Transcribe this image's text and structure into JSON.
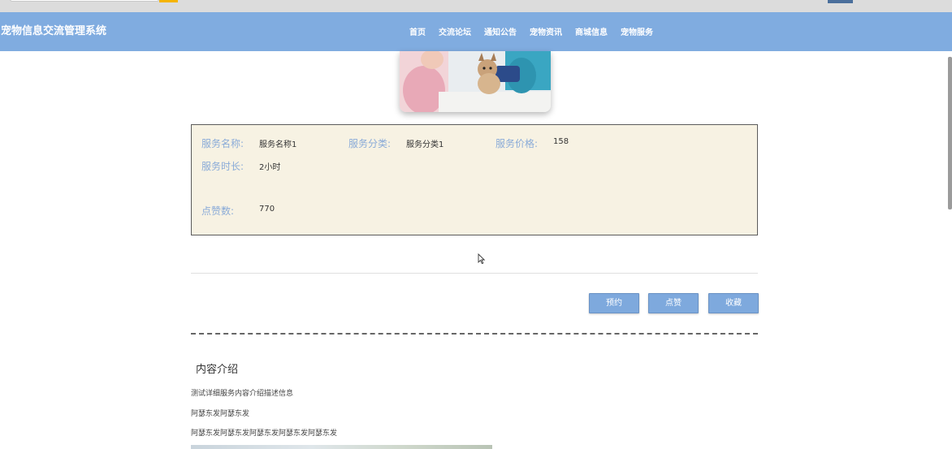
{
  "header": {
    "logo": "宠物信息交流管理系统",
    "nav": [
      "首页",
      "交流论坛",
      "通知公告",
      "宠物资讯",
      "商城信息",
      "宠物服务"
    ]
  },
  "service": {
    "name_label": "服务名称:",
    "name_value": "服务名称1",
    "category_label": "服务分类:",
    "category_value": "服务分类1",
    "price_label": "服务价格:",
    "price_value": "158",
    "duration_label": "服务时长:",
    "duration_value": "2小时",
    "likes_label": "点赞数:",
    "likes_value": "770"
  },
  "actions": {
    "book": "预约",
    "like": "点赞",
    "favorite": "收藏"
  },
  "content": {
    "title": "内容介绍",
    "lines": [
      "测试详细服务内容介绍描述信息",
      "阿瑟东发阿瑟东发",
      "阿瑟东发阿瑟东发阿瑟东发阿瑟东发阿瑟东发"
    ]
  },
  "colors": {
    "navbar": "#80ace0",
    "label": "#8aabd8",
    "button": "#7ea9dd",
    "info_bg": "#f7f2e3"
  }
}
